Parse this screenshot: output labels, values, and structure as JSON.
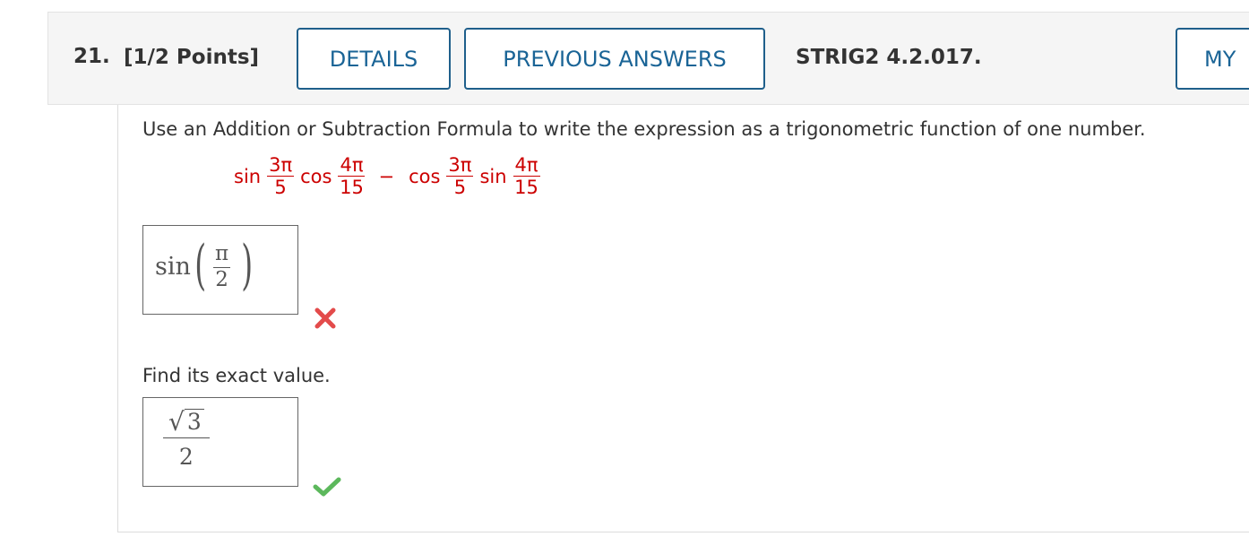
{
  "header": {
    "question_number": "21.",
    "points": "[1/2 Points]",
    "details_button": "DETAILS",
    "previous_answers_button": "PREVIOUS ANSWERS",
    "reference": "STRIG2 4.2.017.",
    "my_button": "MY"
  },
  "question": {
    "prompt": "Use an Addition or Subtraction Formula to write the expression as a trigonometric function of one number.",
    "expression": {
      "term1_fn": "sin",
      "term1_num": "3π",
      "term1_den": "5",
      "term2_fn": "cos",
      "term2_num": "4π",
      "term2_den": "15",
      "operator": "−",
      "term3_fn": "cos",
      "term3_num": "3π",
      "term3_den": "5",
      "term4_fn": "sin",
      "term4_num": "4π",
      "term4_den": "15"
    },
    "answer1": {
      "fn": "sin",
      "num": "π",
      "den": "2",
      "status": "incorrect"
    },
    "followup": "Find its exact value.",
    "answer2": {
      "radicand": "3",
      "den": "2",
      "status": "correct"
    }
  },
  "colors": {
    "accent_blue": "#1a6496",
    "expression_red": "#cc0000",
    "incorrect_red": "#e34b4b",
    "correct_green": "#5cb85c"
  }
}
